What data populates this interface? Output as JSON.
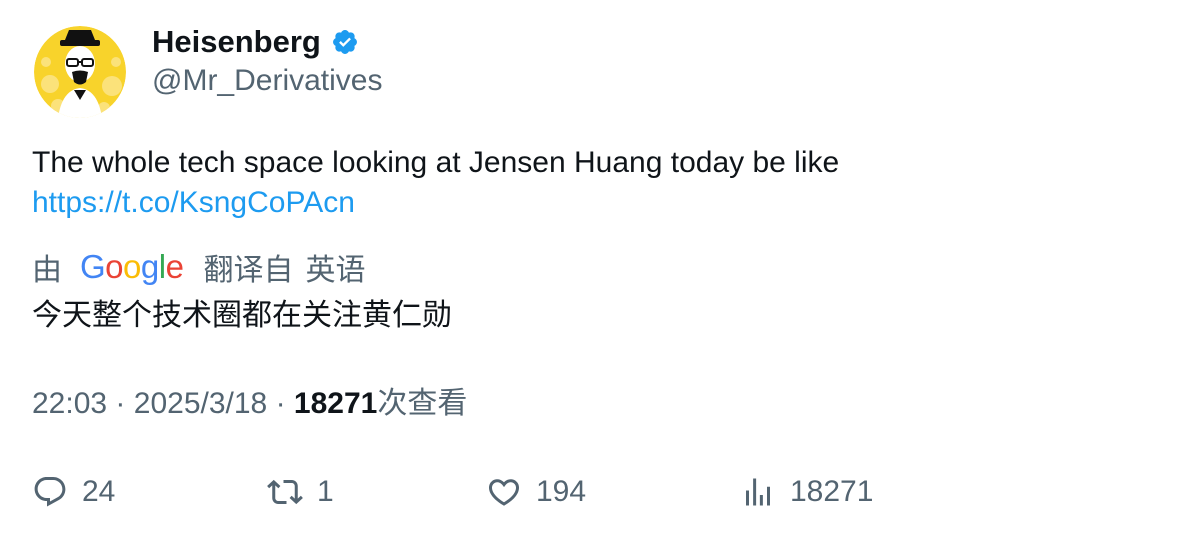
{
  "author": {
    "display_name": "Heisenberg",
    "handle": "@Mr_Derivatives",
    "verified": true,
    "verified_color": "#1d9bf0"
  },
  "tweet": {
    "text": "The whole tech space looking at Jensen Huang today be like",
    "link": "https://t.co/KsngCoPAcn"
  },
  "translation": {
    "prefix": "由",
    "provider_parts": [
      "G",
      "o",
      "o",
      "g",
      "l",
      "e"
    ],
    "suffix": "翻译自",
    "source_language": "英语",
    "text": "今天整个技术圈都在关注黄仁勋"
  },
  "meta": {
    "time": "22:03",
    "separator": "·",
    "date": "2025/3/18",
    "views_count": "18271",
    "views_label": "次查看"
  },
  "actions": {
    "reply_count": "24",
    "retweet_count": "1",
    "like_count": "194",
    "views_count": "18271"
  },
  "icons": {
    "verified": "verified-badge-icon",
    "reply": "reply-icon",
    "retweet": "retweet-icon",
    "like": "heart-icon",
    "views": "views-bar-chart-icon"
  },
  "colors": {
    "text_primary": "#0f1419",
    "text_secondary": "#536471",
    "link": "#1d9bf0"
  }
}
